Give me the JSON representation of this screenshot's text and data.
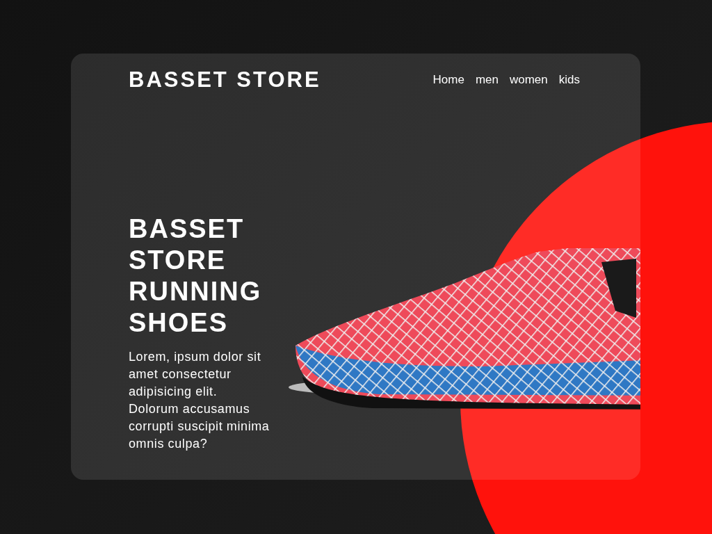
{
  "header": {
    "brand": "BASSET STORE",
    "nav": [
      "Home",
      "men",
      "women",
      "kids"
    ]
  },
  "hero": {
    "title": "BASSET STORE RUNNING SHOES",
    "description": "Lorem, ipsum dolor sit amet consectetur adipisicing elit. Dolorum accusamus corrupti suscipit minima omnis culpa?"
  }
}
